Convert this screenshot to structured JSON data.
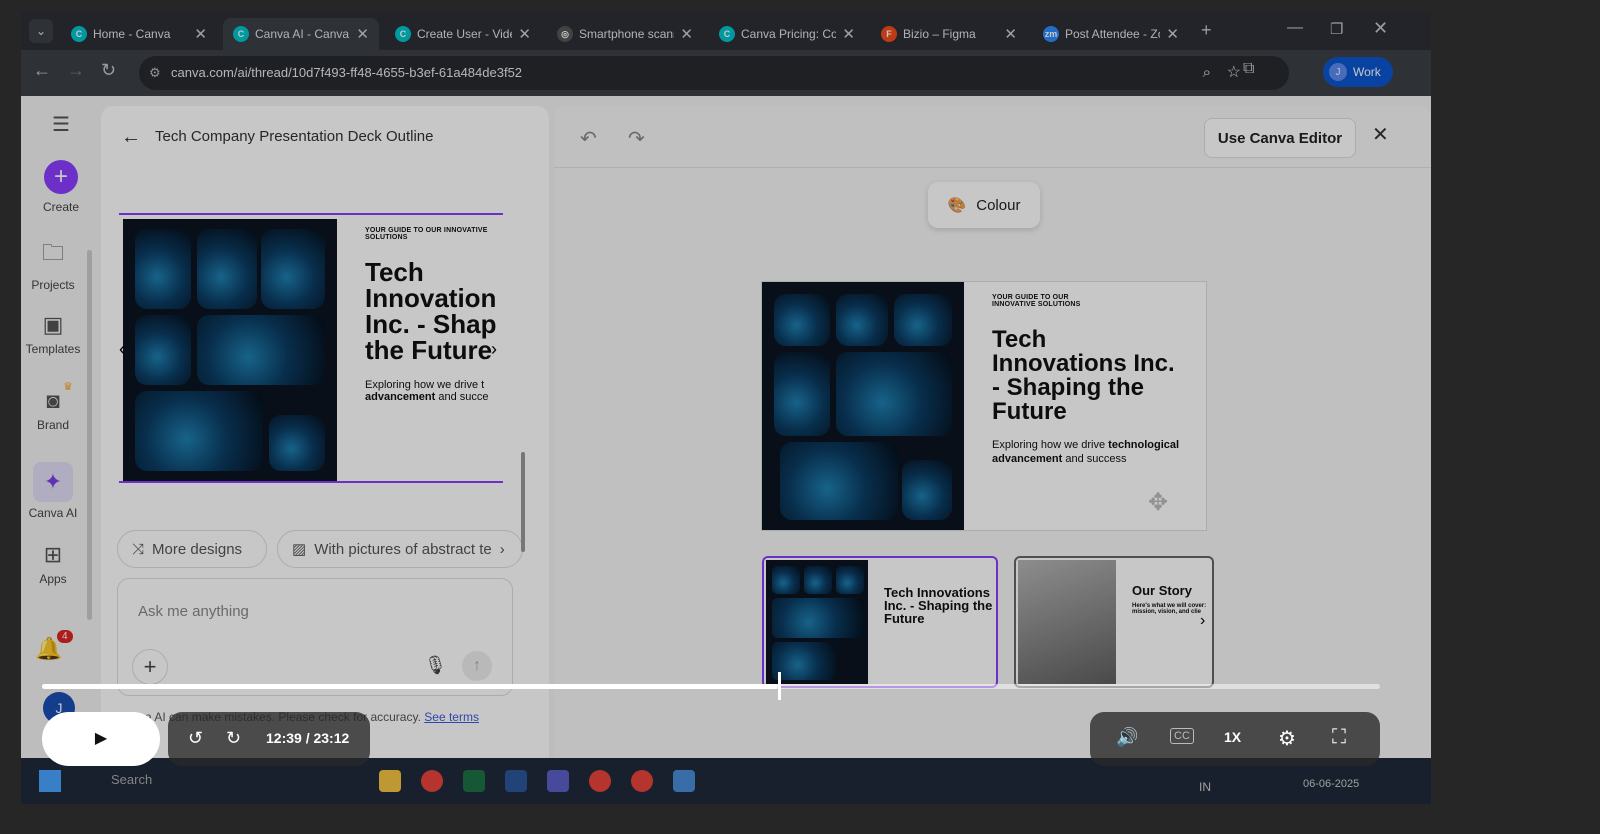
{
  "browser": {
    "tabs": [
      {
        "title": "Home - Canva",
        "color": "#00c4cc",
        "glyph": "C"
      },
      {
        "title": "Canva AI - Canva",
        "color": "#00c4cc",
        "glyph": "C",
        "active": true
      },
      {
        "title": "Create User - Videc",
        "color": "#00c4cc",
        "glyph": "C"
      },
      {
        "title": "Smartphone scann",
        "color": "#555",
        "glyph": "◎"
      },
      {
        "title": "Canva Pricing: Com",
        "color": "#00c4cc",
        "glyph": "C"
      },
      {
        "title": "Bizio – Figma",
        "color": "#f24e1e",
        "glyph": "F"
      },
      {
        "title": "Post Attendee - Zo",
        "color": "#2d8cff",
        "glyph": "zm"
      }
    ],
    "url": "canva.com/ai/thread/10d7f493-ff48-4655-b3ef-61a484de3f52",
    "profile": "Work",
    "profile_initial": "J"
  },
  "rail": {
    "create": "Create",
    "projects": "Projects",
    "templates": "Templates",
    "brand": "Brand",
    "canva_ai": "Canva AI",
    "apps": "Apps",
    "notif_count": "4",
    "user_initial": "J"
  },
  "chat": {
    "title": "Tech Company Presentation Deck Outline",
    "more_designs": "More designs",
    "suggestion": "With pictures of abstract te",
    "input_placeholder": "Ask me anything",
    "disclaimer": "Canva AI can make mistakes. Please check for accuracy.",
    "see_terms": "See terms"
  },
  "slide": {
    "eyebrow": "YOUR GUIDE TO OUR INNOVATIVE SOLUTIONS",
    "title": "Tech Innovations Inc. - Shaping the Future",
    "body_plain": "Exploring how we drive ",
    "body_bold1": "technological advancement",
    "body_end": " and success",
    "chat_title": "Tech Innovation Inc. - Shap the Future",
    "chat_body": "Exploring how we drive t",
    "chat_bold": "advancement",
    "chat_end": " and succe"
  },
  "editor": {
    "use_editor": "Use Canva Editor",
    "colour": "Colour",
    "thumb2_title": "Our Story",
    "thumb2_body": "Here's what we will cover: mission, vision, and clie"
  },
  "player": {
    "current": "12:39",
    "total": "/ 23:12",
    "speed": "1X",
    "progress": 0.55
  },
  "taskbar": {
    "search": "Search",
    "lang": "IN",
    "date": "06-06-2025"
  }
}
